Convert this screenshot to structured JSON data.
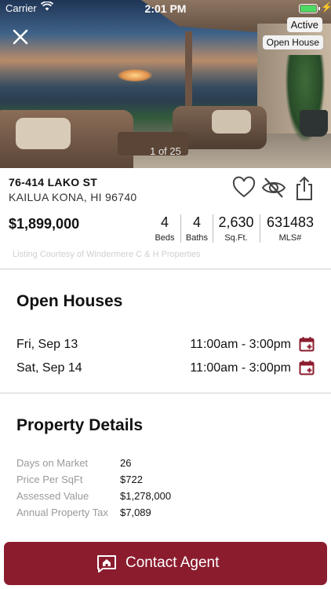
{
  "status_bar": {
    "carrier": "Carrier",
    "time": "2:01 PM"
  },
  "listing": {
    "status_badge": "Active",
    "open_house_badge": "Open House",
    "photo_counter": "1 of 25",
    "address_line1": "76-414 LAKO ST",
    "address_line2": "KAILUA KONA, HI 96740",
    "price": "$1,899,000",
    "stats": [
      {
        "value": "4",
        "label": "Beds"
      },
      {
        "value": "4",
        "label": "Baths"
      },
      {
        "value": "2,630",
        "label": "Sq.Ft."
      },
      {
        "value": "631483",
        "label": "MLS#"
      }
    ],
    "courtesy": "Listing Courtesy of Windermere C & H Properties"
  },
  "open_houses": {
    "title": "Open Houses",
    "items": [
      {
        "day": "Fri, Sep 13",
        "time": "11:00am - 3:00pm"
      },
      {
        "day": "Sat, Sep 14",
        "time": "11:00am - 3:00pm"
      }
    ]
  },
  "property_details": {
    "title": "Property Details",
    "rows": [
      {
        "label": "Days on Market",
        "value": "26"
      },
      {
        "label": "Price Per SqFt",
        "value": "$722"
      },
      {
        "label": "Assessed Value",
        "value": "$1,278,000"
      },
      {
        "label": "Annual Property Tax",
        "value": "$7,089"
      }
    ]
  },
  "contact_button": {
    "label": "Contact Agent"
  },
  "colors": {
    "brand": "#8b1c2e",
    "battery": "#4cd964"
  },
  "icons": [
    "close-icon",
    "heart-icon",
    "hide-icon",
    "share-icon",
    "calendar-add-icon",
    "chat-home-icon"
  ]
}
